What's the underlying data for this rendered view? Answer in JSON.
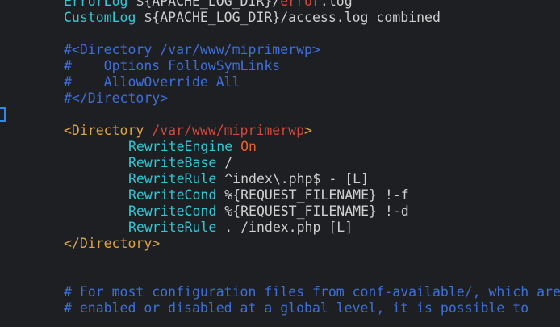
{
  "colors": {
    "background": "#1e1f23",
    "comment": "#3e6fd8",
    "plain": "#cfcfcf",
    "tag": "#e0a640",
    "path": "#d2473b",
    "directive": "#2ec9d6",
    "value": "#e0622e",
    "cursor": "#2f8ae6"
  },
  "lines": [
    {
      "indent": 2,
      "tokens": [
        {
          "text": "ErrorLog",
          "c": "directive"
        },
        {
          "text": " ${APACHE_LOG_DIR}/",
          "c": "plain"
        },
        {
          "text": "error",
          "c": "path"
        },
        {
          "text": ".log",
          "c": "plain"
        }
      ]
    },
    {
      "indent": 2,
      "tokens": [
        {
          "text": "CustomLog",
          "c": "directive"
        },
        {
          "text": " ${APACHE_LOG_DIR}/access.log combined",
          "c": "plain"
        }
      ]
    },
    {
      "indent": 0,
      "tokens": []
    },
    {
      "indent": 2,
      "tokens": [
        {
          "text": "#<Directory /var/www/miprimerwp>",
          "c": "comment"
        }
      ]
    },
    {
      "indent": 2,
      "tokens": [
        {
          "text": "#    Options FollowSymLinks",
          "c": "comment"
        }
      ]
    },
    {
      "indent": 2,
      "tokens": [
        {
          "text": "#    AllowOverride All",
          "c": "comment"
        }
      ]
    },
    {
      "indent": 2,
      "tokens": [
        {
          "text": "#</Directory>",
          "c": "comment"
        }
      ]
    },
    {
      "indent": 0,
      "tokens": []
    },
    {
      "indent": 2,
      "tokens": [
        {
          "text": "<Directory ",
          "c": "tag"
        },
        {
          "text": "/var/www/miprimerwp",
          "c": "path"
        },
        {
          "text": ">",
          "c": "tag"
        }
      ]
    },
    {
      "indent": 10,
      "tokens": [
        {
          "text": "RewriteEngine",
          "c": "directive"
        },
        {
          "text": " ",
          "c": "plain"
        },
        {
          "text": "On",
          "c": "value"
        }
      ]
    },
    {
      "indent": 10,
      "tokens": [
        {
          "text": "RewriteBase",
          "c": "directive"
        },
        {
          "text": " /",
          "c": "plain"
        }
      ]
    },
    {
      "indent": 10,
      "tokens": [
        {
          "text": "RewriteRule",
          "c": "directive"
        },
        {
          "text": " ^index\\.php$ - [L]",
          "c": "plain"
        }
      ]
    },
    {
      "indent": 10,
      "tokens": [
        {
          "text": "RewriteCond",
          "c": "directive"
        },
        {
          "text": " %{REQUEST_FILENAME} !-f",
          "c": "plain"
        }
      ]
    },
    {
      "indent": 10,
      "tokens": [
        {
          "text": "RewriteCond",
          "c": "directive"
        },
        {
          "text": " %{REQUEST_FILENAME} !-d",
          "c": "plain"
        }
      ]
    },
    {
      "indent": 10,
      "tokens": [
        {
          "text": "RewriteRule",
          "c": "directive"
        },
        {
          "text": " . /index.php [L]",
          "c": "plain"
        }
      ]
    },
    {
      "indent": 2,
      "tokens": [
        {
          "text": "</Directory>",
          "c": "tag"
        }
      ]
    },
    {
      "indent": 0,
      "tokens": []
    },
    {
      "indent": 0,
      "tokens": []
    },
    {
      "indent": 2,
      "tokens": [
        {
          "text": "# For most configuration files from conf-available/, which are",
          "c": "comment"
        }
      ]
    },
    {
      "indent": 2,
      "tokens": [
        {
          "text": "# enabled or disabled at a global level, it is possible to",
          "c": "comment"
        }
      ]
    }
  ]
}
